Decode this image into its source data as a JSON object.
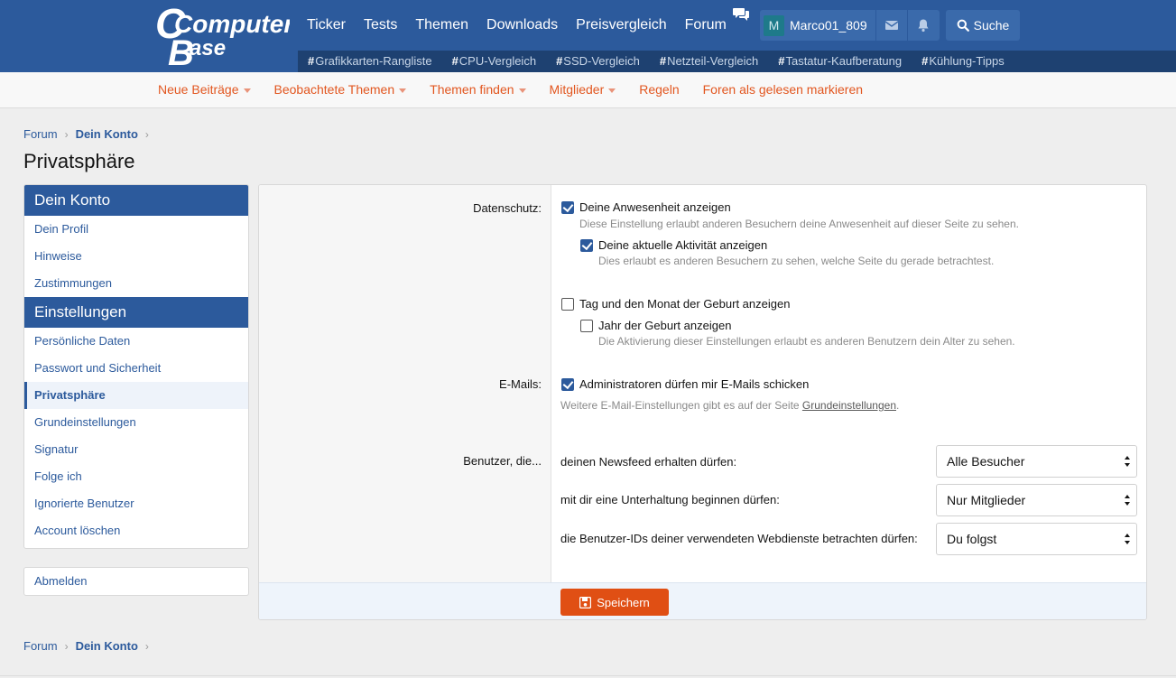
{
  "header": {
    "logo_line1": "Computer",
    "logo_line2": "Base",
    "nav": [
      "Ticker",
      "Tests",
      "Themen",
      "Downloads",
      "Preisvergleich",
      "Forum"
    ],
    "user": {
      "avatar_letter": "M",
      "name": "Marco01_809"
    },
    "search_label": "Suche",
    "tags": [
      "Grafikkarten-Rangliste",
      "CPU-Vergleich",
      "SSD-Vergleich",
      "Netzteil-Vergleich",
      "Tastatur-Kaufberatung",
      "Kühlung-Tipps"
    ],
    "tag_prefix": "#"
  },
  "subnav": [
    "Neue Beiträge",
    "Beobachtete Themen",
    "Themen finden",
    "Mitglieder",
    "Regeln",
    "Foren als gelesen markieren"
  ],
  "breadcrumb": {
    "root": "Forum",
    "current": "Dein Konto"
  },
  "page_title": "Privatsphäre",
  "sidebar": {
    "section1_title": "Dein Konto",
    "section1_items": [
      "Dein Profil",
      "Hinweise",
      "Zustimmungen"
    ],
    "section2_title": "Einstellungen",
    "section2_items": [
      "Persönliche Daten",
      "Passwort und Sicherheit",
      "Privatsphäre",
      "Grundeinstellungen",
      "Signatur",
      "Folge ich",
      "Ignorierte Benutzer",
      "Account löschen"
    ],
    "active_item": "Privatsphäre",
    "logout": "Abmelden"
  },
  "form": {
    "privacy_label": "Datenschutz:",
    "show_presence": {
      "label": "Deine Anwesenheit anzeigen",
      "checked": true,
      "hint": "Diese Einstellung erlaubt anderen Besuchern deine Anwesenheit auf dieser Seite zu sehen."
    },
    "show_activity": {
      "label": "Deine aktuelle Aktivität anzeigen",
      "checked": true,
      "hint": "Dies erlaubt es anderen Besuchern zu sehen, welche Seite du gerade betrachtest."
    },
    "show_birthday": {
      "label": "Tag und den Monat der Geburt anzeigen",
      "checked": false
    },
    "show_birth_year": {
      "label": "Jahr der Geburt anzeigen",
      "checked": false,
      "hint": "Die Aktivierung dieser Einstellungen erlaubt es anderen Benutzern dein Alter zu sehen."
    },
    "email_label": "E-Mails:",
    "admin_email": {
      "label": "Administratoren dürfen mir E-Mails schicken",
      "checked": true,
      "hint_prefix": "Weitere E-Mail-Einstellungen gibt es auf der Seite ",
      "hint_link": "Grundeinstellungen",
      "hint_suffix": "."
    },
    "users_label": "Benutzer, die...",
    "permissions": [
      {
        "label": "deinen Newsfeed erhalten dürfen:",
        "value": "Alle Besucher"
      },
      {
        "label": "mit dir eine Unterhaltung beginnen dürfen:",
        "value": "Nur Mitglieder"
      },
      {
        "label": "die Benutzer-IDs deiner verwendeten Webdienste betrachten dürfen:",
        "value": "Du folgst"
      }
    ],
    "save_label": "Speichern"
  },
  "colors": {
    "brand_blue": "#2c5a9c",
    "accent_orange": "#e04f14"
  }
}
